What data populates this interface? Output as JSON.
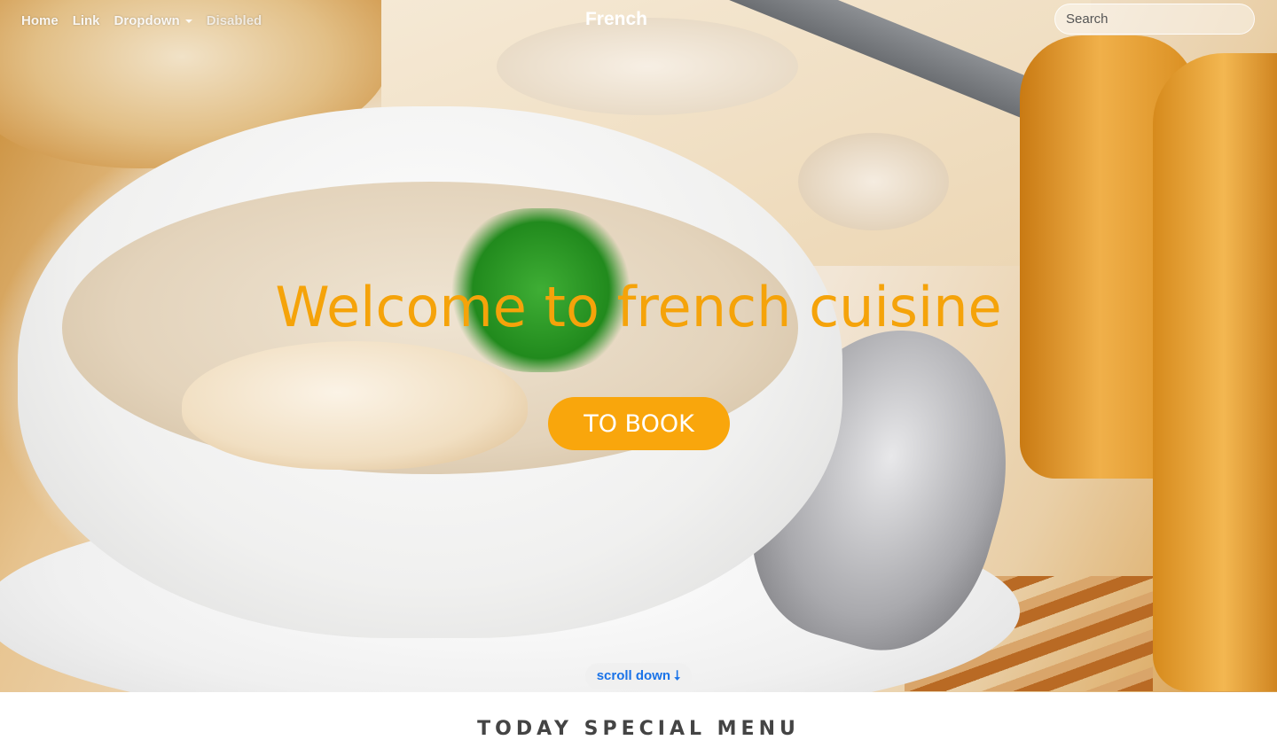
{
  "nav": {
    "links": [
      "Home",
      "Link",
      "Dropdown",
      "Disabled"
    ],
    "brand": "French",
    "search_placeholder": "Search"
  },
  "hero": {
    "title": "Welcome to french cuisine",
    "cta_label": "TO BOOK",
    "scroll_label": "scroll down",
    "scroll_arrow": "⭣"
  },
  "section": {
    "heading": "TODAY SPECIAL MENU"
  },
  "colors": {
    "accent": "#f9a60c",
    "title": "#f5a30a",
    "scroll_link": "#1a73e8"
  },
  "icons": {
    "dropdown": "caret-down-icon",
    "scroll": "arrow-down-icon"
  }
}
